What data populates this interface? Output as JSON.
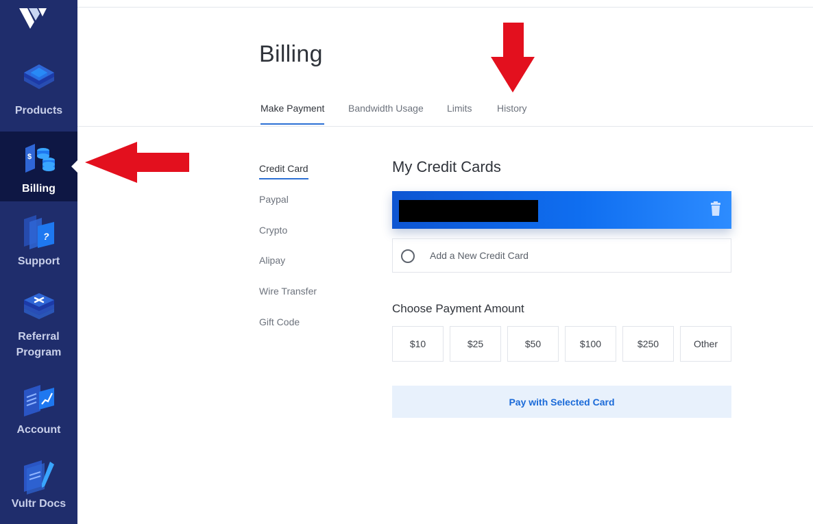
{
  "sidebar": {
    "items": [
      {
        "label": "Products",
        "icon": "products-icon"
      },
      {
        "label": "Billing",
        "icon": "billing-icon"
      },
      {
        "label": "Support",
        "icon": "support-icon"
      },
      {
        "label": "Referral Program",
        "icon": "referral-icon"
      },
      {
        "label": "Account",
        "icon": "account-icon"
      },
      {
        "label": "Vultr Docs",
        "icon": "docs-icon"
      }
    ],
    "active": "Billing"
  },
  "page": {
    "title": "Billing"
  },
  "tabs": [
    "Make Payment",
    "Bandwidth Usage",
    "Limits",
    "History"
  ],
  "active_tab": "Make Payment",
  "payment_methods": [
    "Credit Card",
    "Paypal",
    "Crypto",
    "Alipay",
    "Wire Transfer",
    "Gift Code"
  ],
  "active_method": "Credit Card",
  "cards": {
    "title": "My Credit Cards",
    "add_label": "Add a New Credit Card"
  },
  "amount": {
    "title": "Choose Payment Amount",
    "options": [
      "$10",
      "$25",
      "$50",
      "$100",
      "$250",
      "Other"
    ]
  },
  "pay_button": "Pay with Selected Card",
  "colors": {
    "sidebar_bg": "#1f2d6c",
    "sidebar_active_bg": "#0e1744",
    "accent": "#2b6fd4",
    "card_gradient_start": "#0d55d2",
    "card_gradient_end": "#2d8cff",
    "pay_button_bg": "#e8f1fc",
    "annotation_arrow": "#e3101e"
  }
}
